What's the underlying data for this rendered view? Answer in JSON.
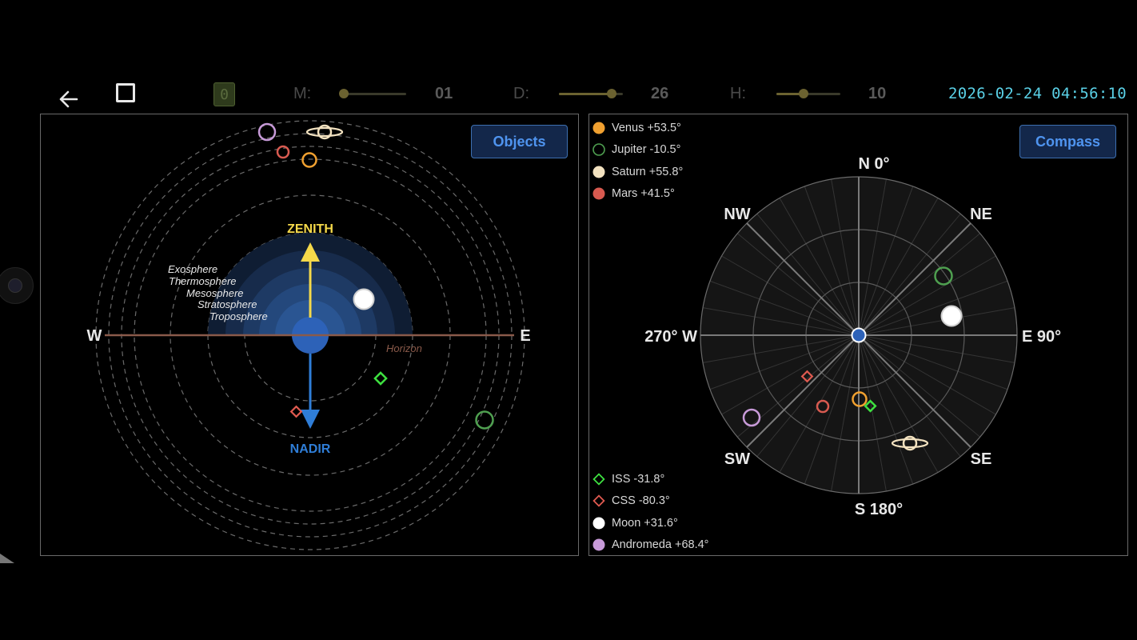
{
  "toolbar": {
    "zero_badge": "0",
    "month": {
      "label": "M:",
      "value": "01",
      "fraction": 0.0
    },
    "day": {
      "label": "D:",
      "value": "26",
      "fraction": 0.83
    },
    "hour": {
      "label": "H:",
      "value": "10",
      "fraction": 0.43
    },
    "clock": "2026-02-24 04:56:10"
  },
  "side_view": {
    "objects_button": "Objects",
    "zenith": "ZENITH",
    "nadir": "NADIR",
    "west": "W",
    "east": "E",
    "horizon": "Horizon",
    "layers": [
      "Exosphere",
      "Thermosphere",
      "Mesosphere",
      "Stratosphere",
      "Troposphere"
    ]
  },
  "compass_view": {
    "compass_button": "Compass",
    "north": "N 0°",
    "south": "S 180°",
    "east": "E 90°",
    "west": "270° W",
    "ne": "NE",
    "nw": "NW",
    "se": "SE",
    "sw": "SW"
  },
  "legend_top": [
    {
      "name": "Venus +53.5°",
      "marker": "filled-circle",
      "color": "#f0a030"
    },
    {
      "name": "Jupiter -10.5°",
      "marker": "hollow-circle",
      "color": "#4fa050"
    },
    {
      "name": "Saturn +55.8°",
      "marker": "filled-circle",
      "color": "#f3e2c0"
    },
    {
      "name": "Mars +41.5°",
      "marker": "filled-circle",
      "color": "#d85a50"
    }
  ],
  "legend_bottom": [
    {
      "name": "ISS -31.8°",
      "marker": "hollow-diamond",
      "color": "#3ee040"
    },
    {
      "name": "CSS -80.3°",
      "marker": "hollow-diamond",
      "color": "#e05a50"
    },
    {
      "name": "Moon +31.6°",
      "marker": "filled-circle",
      "color": "#ffffff"
    },
    {
      "name": "Andromeda +68.4°",
      "marker": "filled-circle",
      "color": "#c79ad8"
    }
  ],
  "colors": {
    "accent_blue": "#4f94ef",
    "zenith_yellow": "#f5d94a",
    "nadir_blue": "#2f7ed8",
    "clock_cyan": "#5ad0e6",
    "horizon_brown": "#8a5a4a"
  }
}
